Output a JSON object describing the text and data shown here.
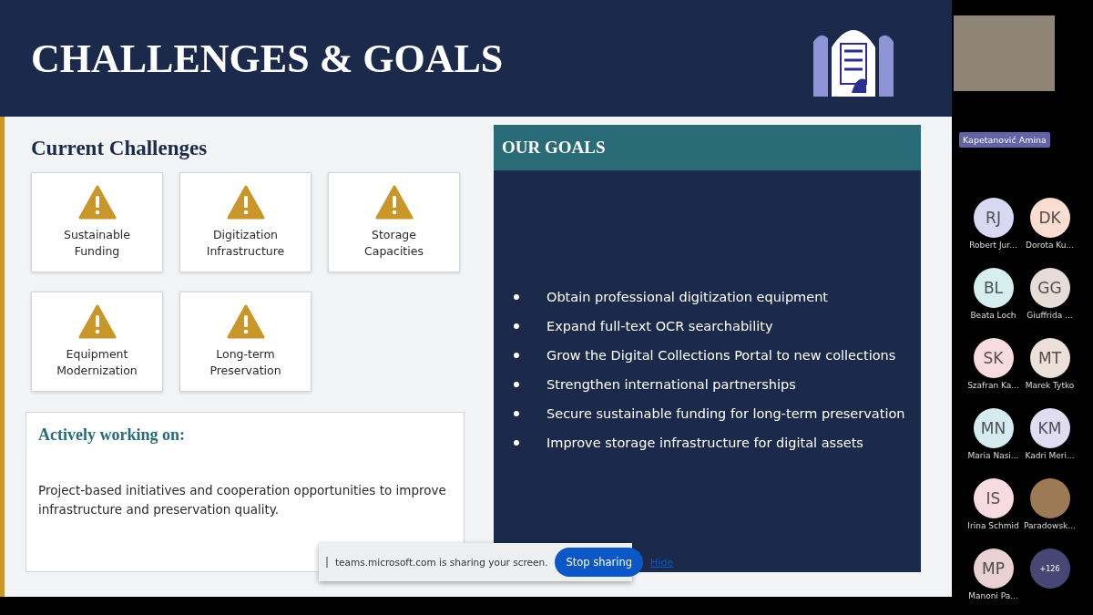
{
  "slide": {
    "title": "CHALLENGES & GOALS",
    "challenges": {
      "heading": "Current Challenges",
      "items": [
        {
          "label": "Sustainable Funding"
        },
        {
          "label": "Digitization Infrastructure"
        },
        {
          "label": "Storage Capacities"
        },
        {
          "label": "Equipment Modernization"
        },
        {
          "label": "Long-term Preservation"
        }
      ]
    },
    "working": {
      "heading": "Actively working on:",
      "text": "Project-based initiatives and cooperation opportunities to improve infrastructure and preservation quality."
    },
    "goals": {
      "heading": "OUR GOALS",
      "items": [
        "Obtain professional digitization equipment",
        "Expand full-text OCR searchability",
        "Grow the Digital Collections Portal to new collections",
        "Strengthen international partnerships",
        "Secure sustainable funding for long-term preservation",
        "Improve storage infrastructure for digital assets"
      ]
    }
  },
  "share_bar": {
    "message": "teams.microsoft.com is sharing your screen.",
    "stop_button": "Stop sharing",
    "hide_link": "Hide"
  },
  "presenter": {
    "name": "Kapetanović Amina"
  },
  "participants": [
    {
      "kind": "initials",
      "initials": "RJ",
      "name": "Robert Jur...",
      "color": "#d9d8f3"
    },
    {
      "kind": "initials",
      "initials": "DK",
      "name": "Dorota Ku...",
      "color": "#f9dcd2"
    },
    {
      "kind": "initials",
      "initials": "BL",
      "name": "Beata Loch",
      "color": "#d6eef0"
    },
    {
      "kind": "initials",
      "initials": "GG",
      "name": "Giuffrida ...",
      "color": "#e8ddd6"
    },
    {
      "kind": "initials",
      "initials": "SK",
      "name": "Szafran Ka...",
      "color": "#f8dbe0"
    },
    {
      "kind": "initials",
      "initials": "MT",
      "name": "Marek Tytko",
      "color": "#ece0d8"
    },
    {
      "kind": "initials",
      "initials": "MN",
      "name": "Maria Nasi...",
      "color": "#d6ebef"
    },
    {
      "kind": "initials",
      "initials": "KM",
      "name": "Kadri Meri...",
      "color": "#e0ddf2"
    },
    {
      "kind": "initials",
      "initials": "IS",
      "name": "Irina Schmid",
      "color": "#f8dbe0"
    },
    {
      "kind": "photo",
      "name": "Paradowsk..."
    },
    {
      "kind": "initials",
      "initials": "MP",
      "name": "Manoni Pa...",
      "color": "#e9d0d3"
    },
    {
      "kind": "more",
      "initials": "+126",
      "color": "#464775"
    }
  ]
}
